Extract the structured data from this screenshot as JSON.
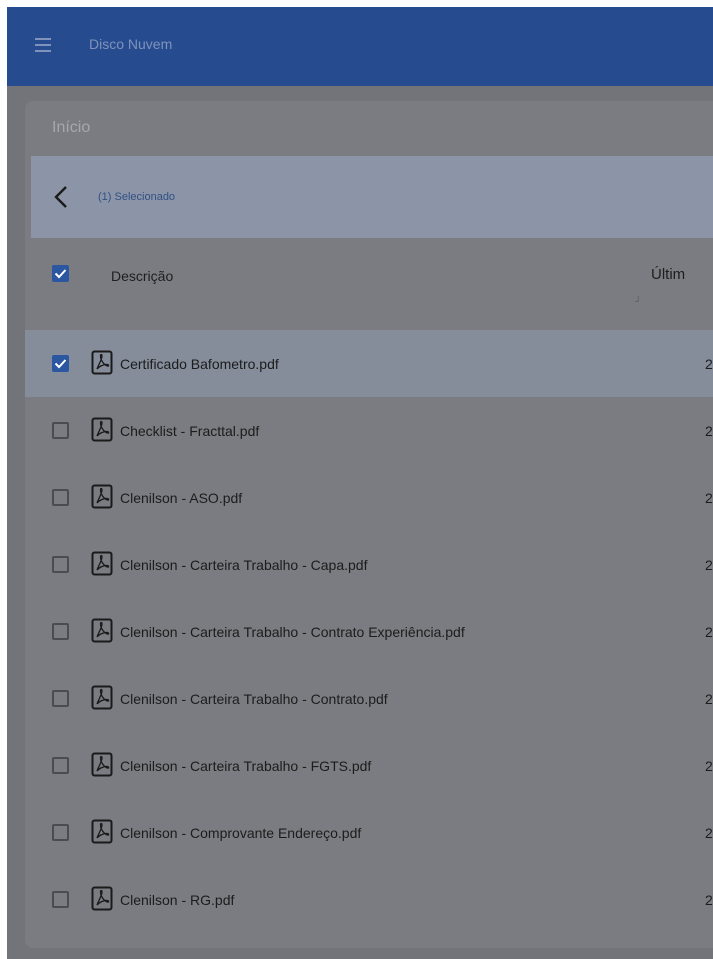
{
  "appbar": {
    "title": "Disco Nuvem",
    "menu_icon": "hamburger-menu-icon"
  },
  "breadcrumb": "Início",
  "selection": {
    "text": "(1) Selecionado",
    "back_icon": "chevron-left-icon"
  },
  "table": {
    "columns": {
      "description": "Descrição",
      "last_modified": "Últim"
    },
    "rows": [
      {
        "name": "Certificado Bafometro.pdf",
        "checked": true,
        "date": "2"
      },
      {
        "name": "Checklist - Fracttal.pdf",
        "checked": false,
        "date": "2"
      },
      {
        "name": "Clenilson - ASO.pdf",
        "checked": false,
        "date": "2"
      },
      {
        "name": "Clenilson - Carteira Trabalho - Capa.pdf",
        "checked": false,
        "date": "2"
      },
      {
        "name": "Clenilson - Carteira Trabalho - Contrato Experiência.pdf",
        "checked": false,
        "date": "2"
      },
      {
        "name": "Clenilson - Carteira Trabalho - Contrato.pdf",
        "checked": false,
        "date": "2"
      },
      {
        "name": "Clenilson - Carteira Trabalho - FGTS.pdf",
        "checked": false,
        "date": "2"
      },
      {
        "name": "Clenilson - Comprovante Endereço.pdf",
        "checked": false,
        "date": "2"
      },
      {
        "name": "Clenilson - RG.pdf",
        "checked": false,
        "date": "2"
      }
    ]
  },
  "colors": {
    "appbar": "#264b8f",
    "accent": "#2b56a0",
    "overlay": "#727479"
  }
}
